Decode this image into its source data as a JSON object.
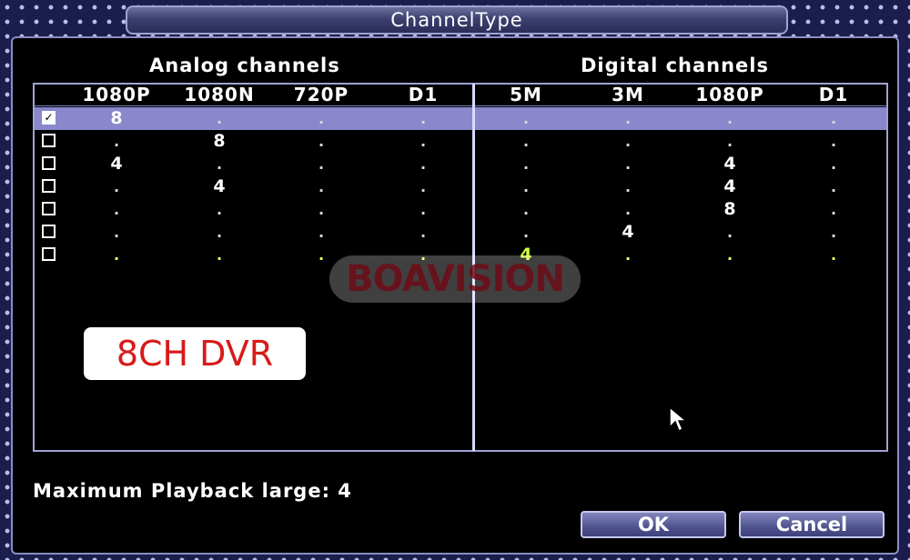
{
  "window": {
    "title": "ChannelType"
  },
  "analog": {
    "heading": "Analog channels",
    "columns": [
      "1080P",
      "1080N",
      "720P",
      "D1"
    ]
  },
  "digital": {
    "heading": "Digital channels",
    "columns": [
      "5M",
      "3M",
      "1080P",
      "D1"
    ]
  },
  "rows": [
    {
      "checked": true,
      "analog": [
        "8",
        ".",
        ".",
        "."
      ],
      "digital": [
        ".",
        ".",
        ".",
        "."
      ]
    },
    {
      "checked": false,
      "analog": [
        ".",
        "8",
        ".",
        "."
      ],
      "digital": [
        ".",
        ".",
        ".",
        "."
      ]
    },
    {
      "checked": false,
      "analog": [
        "4",
        ".",
        ".",
        "."
      ],
      "digital": [
        ".",
        ".",
        "4",
        "."
      ]
    },
    {
      "checked": false,
      "analog": [
        ".",
        "4",
        ".",
        "."
      ],
      "digital": [
        ".",
        ".",
        "4",
        "."
      ]
    },
    {
      "checked": false,
      "analog": [
        ".",
        ".",
        ".",
        "."
      ],
      "digital": [
        ".",
        ".",
        "8",
        "."
      ]
    },
    {
      "checked": false,
      "analog": [
        ".",
        ".",
        ".",
        "."
      ],
      "digital": [
        ".",
        "4",
        ".",
        "."
      ]
    },
    {
      "checked": false,
      "analog": [
        ".",
        ".",
        ".",
        "."
      ],
      "digital": [
        "4",
        ".",
        ".",
        "."
      ]
    }
  ],
  "selected_row": 0,
  "watermark": "BOAVISION",
  "badge": "8CH DVR",
  "footer": {
    "max_playback": "Maximum Playback large: 4"
  },
  "buttons": {
    "ok": "OK",
    "cancel": "Cancel"
  },
  "colors": {
    "selected_row": "#8a87cd",
    "badge_text": "#d81a1a",
    "highlight_value": "#cfff3a"
  }
}
